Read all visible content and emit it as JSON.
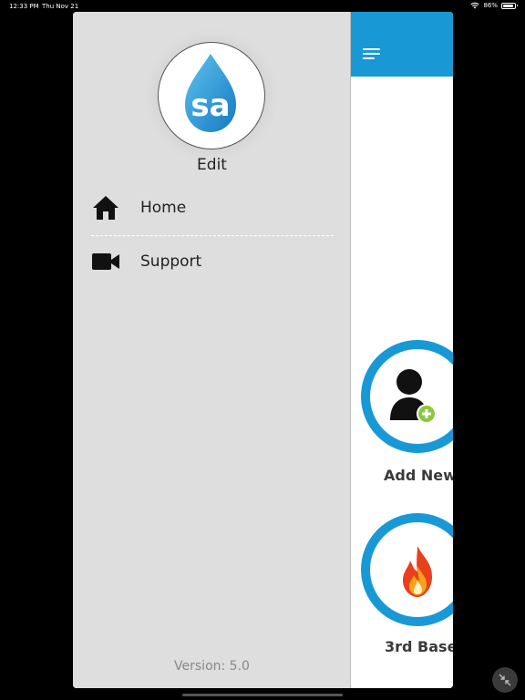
{
  "status_bar": {
    "time": "12:33 PM",
    "date": "Thu Nov 21",
    "battery": "86%"
  },
  "app": {
    "logo_text": "sa",
    "drawer": {
      "edit_label": "Edit",
      "items": [
        {
          "label": "Home",
          "icon": "home-icon"
        },
        {
          "label": "Support",
          "icon": "video-camera-icon"
        }
      ],
      "version": "Version: 5.0"
    },
    "main": {
      "tiles": [
        {
          "label": "Add New",
          "icon": "add-user-icon"
        },
        {
          "label": "3rd Base",
          "icon": "flame-icon"
        }
      ]
    }
  },
  "colors": {
    "accent": "#1899d6",
    "drawer_bg": "#dedede",
    "add_badge": "#8cc63f",
    "flame": "#e8401c"
  }
}
